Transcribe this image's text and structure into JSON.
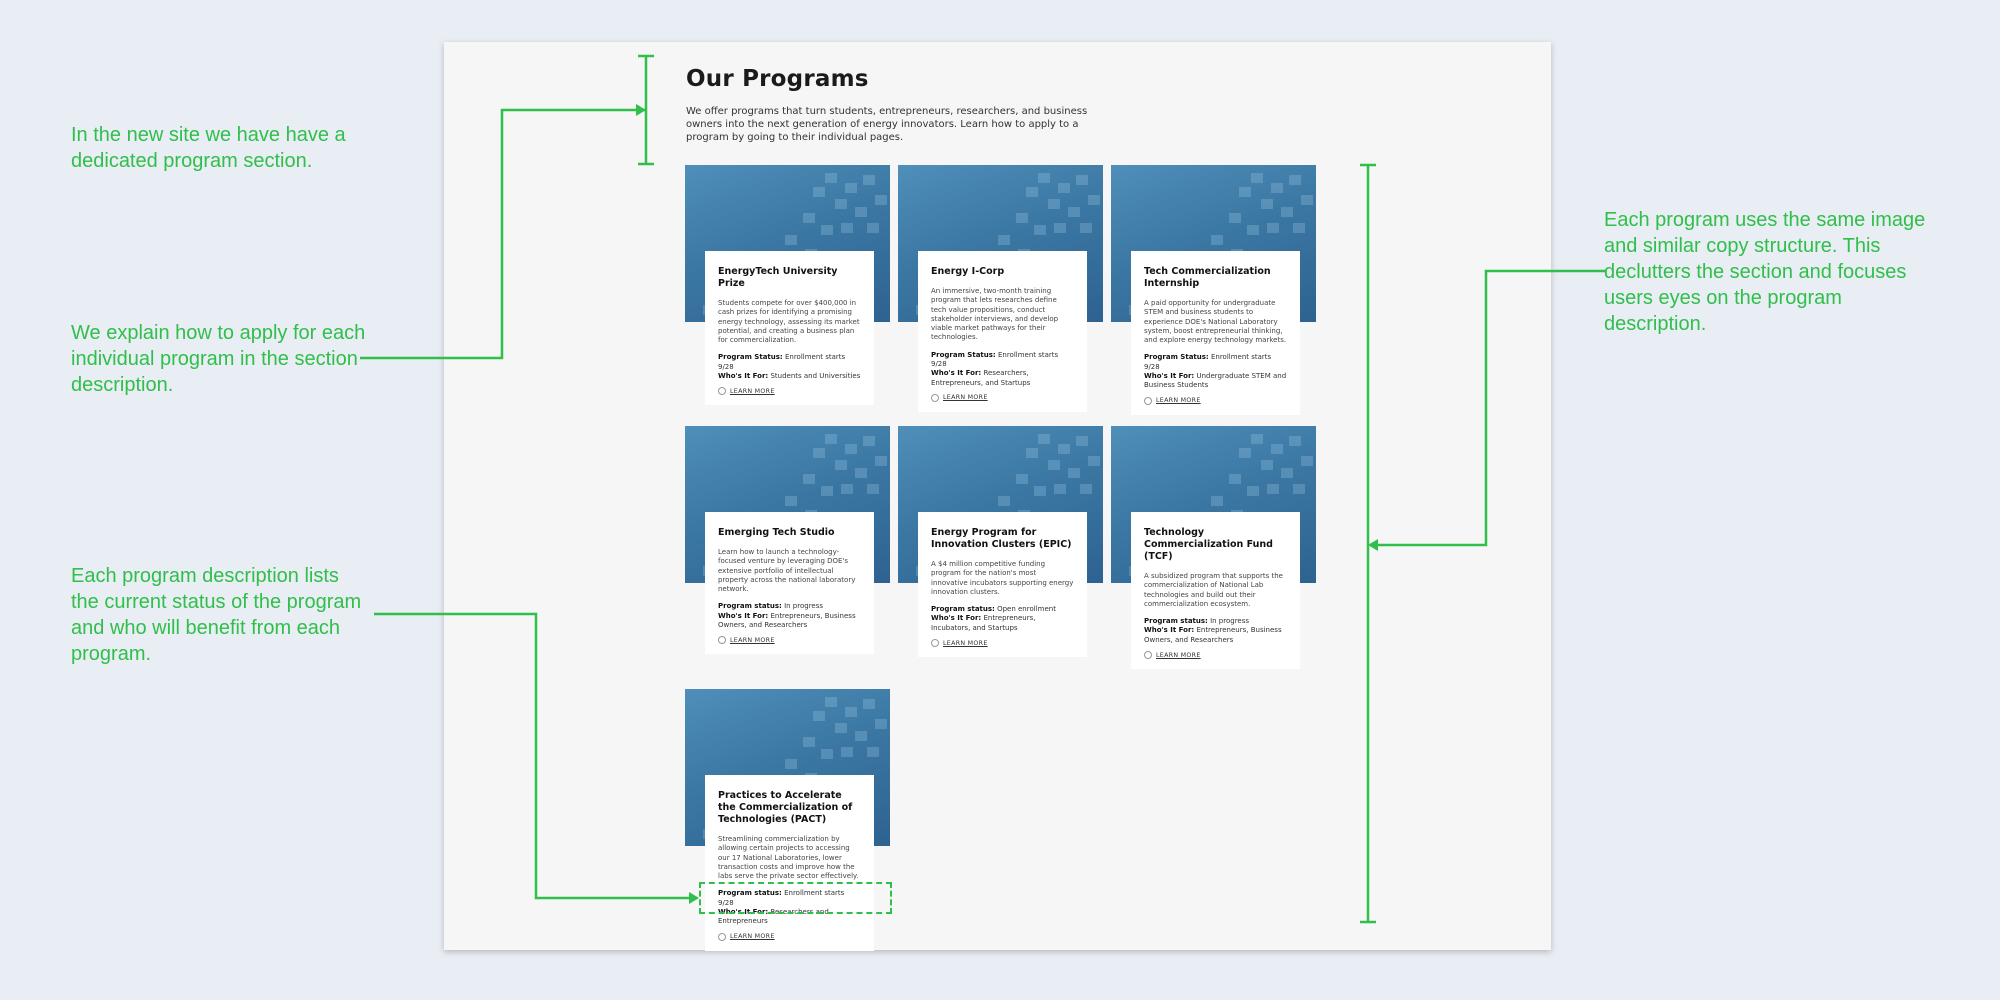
{
  "annotations": [
    "In the new site we have have a dedicated program section.",
    "We explain how to apply for each individual program in the section description.",
    "Each program description lists the current status of the program and who will benefit from each program.",
    "Each program uses the same image and similar copy structure. This declutters the section and focuses users eyes on the program description."
  ],
  "section": {
    "title": "Our Programs",
    "intro": "We offer programs that turn students, entrepreneurs, researchers, and business owners into the next generation of energy innovators. Learn how to apply to a program by going to their individual pages."
  },
  "cards": [
    {
      "title": "EnergyTech University Prize",
      "desc": "Students compete for over $400,000 in cash prizes for identifying a promising energy technology, assessing its market potential, and creating a business plan for commercialization.",
      "status_label": "Program Status:",
      "status": "Enrollment starts 9/28",
      "who_label": "Who's It For:",
      "who": "Students and Universities",
      "link": "LEARN MORE"
    },
    {
      "title": "Energy I-Corp",
      "desc": "An immersive, two-month training program that lets researches define tech value propositions, conduct stakeholder interviews, and develop viable market pathways for their technologies.",
      "status_label": "Program Status:",
      "status": "Enrollment starts 9/28",
      "who_label": "Who's It For:",
      "who": "Researchers, Entrepreneurs, and Startups",
      "link": "LEARN MORE"
    },
    {
      "title": "Tech Commercialization Internship",
      "desc": "A paid opportunity for undergraduate STEM and business students to experience DOE's National Laboratory system, boost entrepreneurial thinking, and explore energy technology markets.",
      "status_label": "Program Status:",
      "status": "Enrollment starts 9/28",
      "who_label": "Who's It For:",
      "who": "Undergraduate STEM and Business Students",
      "link": "LEARN MORE"
    },
    {
      "title": "Emerging Tech Studio",
      "desc": "Learn how to launch a technology-focused venture by leveraging DOE's extensive portfolio of intellectual property across the national laboratory network.",
      "status_label": "Program status:",
      "status": "In progress",
      "who_label": "Who's It For:",
      "who": "Entrepreneurs, Business Owners, and Researchers",
      "link": "LEARN MORE"
    },
    {
      "title": "Energy Program for Innovation Clusters (EPIC)",
      "desc": "A $4 million competitive funding program for the nation's most innovative incubators supporting energy innovation clusters.",
      "status_label": "Program status:",
      "status": "Open enrollment",
      "who_label": "Who's It For:",
      "who": "Entrepreneurs, Incubators, and Startups",
      "link": "LEARN MORE"
    },
    {
      "title": "Technology Commercialization Fund (TCF)",
      "desc": "A subsidized program that supports the commercialization of National Lab technologies and build out their commercialization ecosystem.",
      "status_label": "Program status:",
      "status": "In progress",
      "who_label": "Who's It For:",
      "who": "Entrepreneurs, Business Owners, and Researchers",
      "link": "LEARN MORE"
    },
    {
      "title": "Practices to Accelerate the Commercialization of Technologies (PACT)",
      "desc": "Streamlining commercialization by allowing certain projects to accessing our 17 National Laboratories, lower transaction costs and improve how the labs serve the private sector effectively.",
      "status_label": "Program status:",
      "status": "Enrollment starts 9/28",
      "who_label": "Who's It For:",
      "who": "Researchers and Entrepreneurs",
      "link": "LEARN MORE"
    }
  ],
  "colors": {
    "annotation": "#2fbf4a",
    "card_image": "#3c78a4",
    "background": "#e9edf4"
  }
}
